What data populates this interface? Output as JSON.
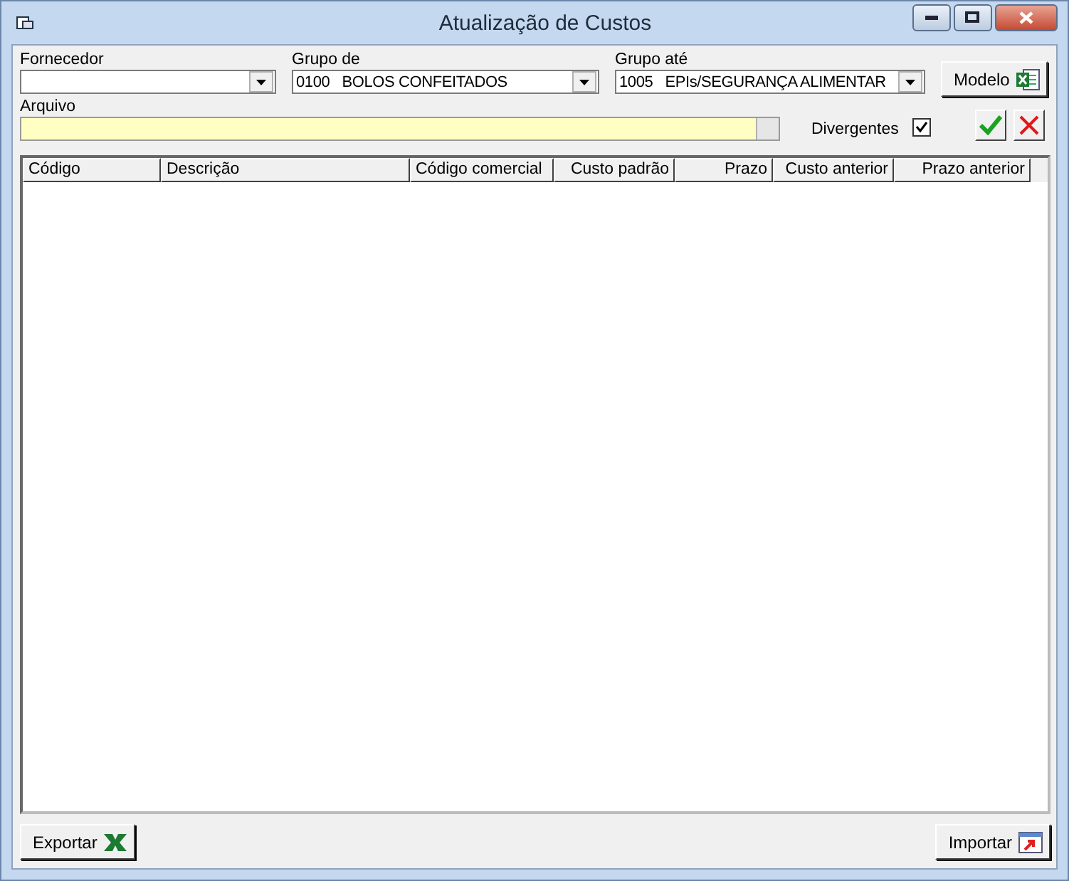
{
  "window": {
    "title": "Atualização de Custos"
  },
  "filters": [
    {
      "label": "Fornecedor"
    },
    {
      "label": "Grupo de",
      "value": "0100   BOLOS CONFEITADOS"
    },
    {
      "label": "Grupo até",
      "value": "1005   EPIs/SEGURANÇA ALIMENTAR"
    }
  ],
  "model_button": {
    "label": "Modelo"
  },
  "file": {
    "label": "Arquivo"
  },
  "divergentes": {
    "label": "Divergentes",
    "checked": true
  },
  "table": {
    "columns": [
      {
        "label": "Código"
      },
      {
        "label": "Descrição"
      },
      {
        "label": "Código comercial"
      },
      {
        "label": "Custo padrão"
      },
      {
        "label": "Prazo"
      },
      {
        "label": "Custo anterior"
      },
      {
        "label": "Prazo anterior"
      }
    ]
  },
  "export_button": {
    "label": "Exportar"
  },
  "import_button": {
    "label": "Importar"
  }
}
